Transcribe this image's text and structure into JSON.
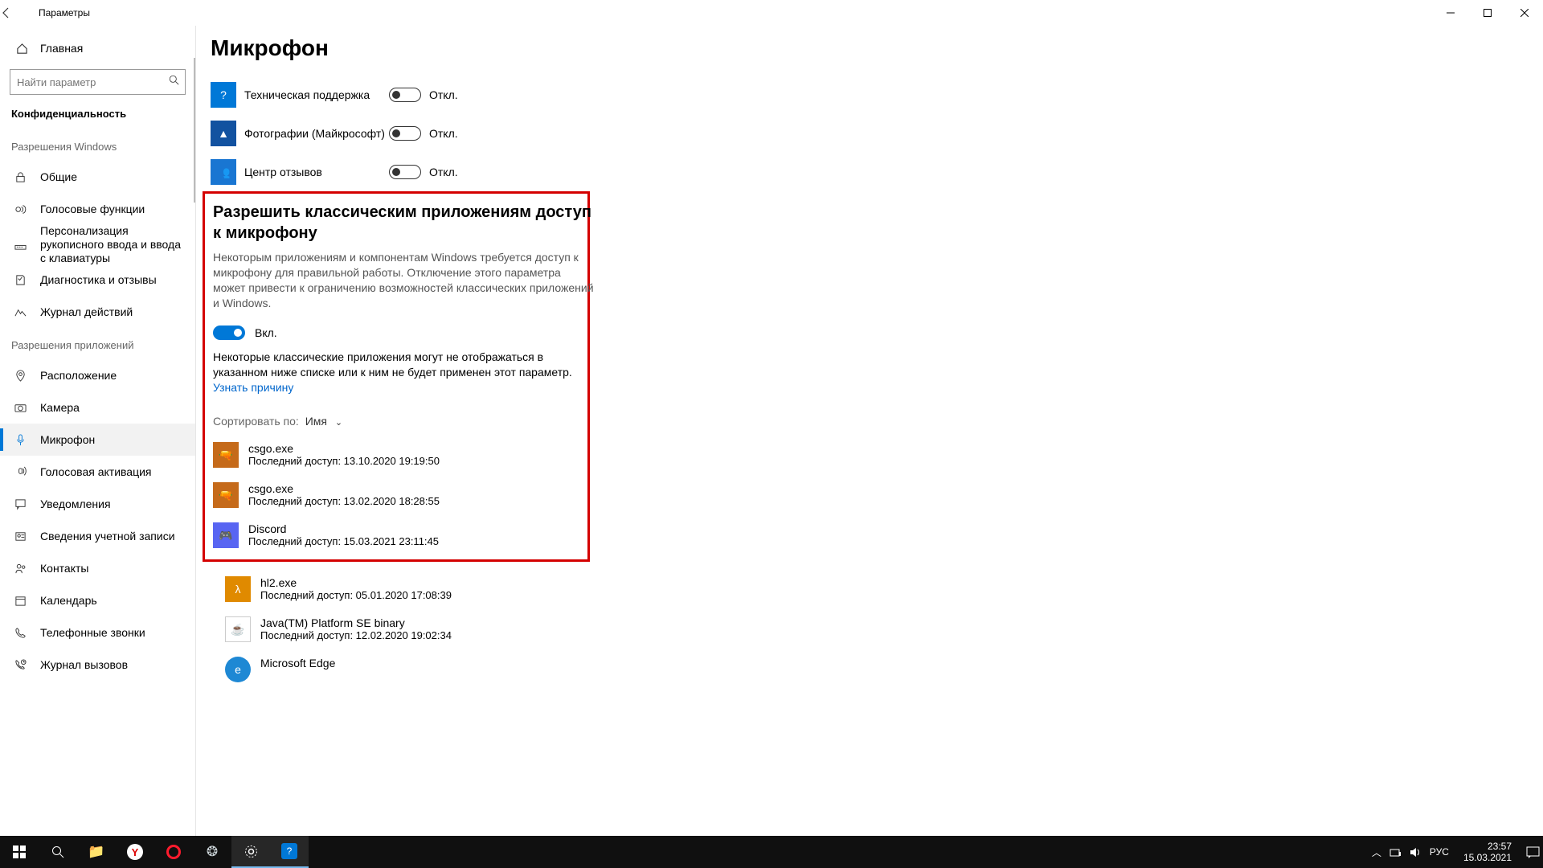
{
  "window": {
    "title": "Параметры"
  },
  "sidebar": {
    "home": "Главная",
    "search_placeholder": "Найти параметр",
    "section": "Конфиденциальность",
    "group_windows": "Разрешения Windows",
    "group_apps": "Разрешения приложений",
    "items_windows": [
      {
        "icon": "lock",
        "label": "Общие"
      },
      {
        "icon": "voice",
        "label": "Голосовые функции"
      },
      {
        "icon": "ink",
        "label": "Персонализация рукописного ввода и ввода с клавиатуры",
        "wrap": true
      },
      {
        "icon": "diag",
        "label": "Диагностика и отзывы"
      },
      {
        "icon": "journal",
        "label": "Журнал действий"
      }
    ],
    "items_apps": [
      {
        "icon": "location",
        "label": "Расположение"
      },
      {
        "icon": "camera",
        "label": "Камера"
      },
      {
        "icon": "mic",
        "label": "Микрофон",
        "active": true
      },
      {
        "icon": "voiceact",
        "label": "Голосовая активация"
      },
      {
        "icon": "notif",
        "label": "Уведомления"
      },
      {
        "icon": "account",
        "label": "Сведения учетной записи"
      },
      {
        "icon": "contacts",
        "label": "Контакты"
      },
      {
        "icon": "calendar",
        "label": "Календарь"
      },
      {
        "icon": "phone",
        "label": "Телефонные звонки"
      },
      {
        "icon": "calllog",
        "label": "Журнал вызовов"
      }
    ]
  },
  "page": {
    "title": "Микрофон",
    "store_apps": [
      {
        "name": "Техническая поддержка",
        "state": "Откл.",
        "icon_bg": "bg-blue",
        "glyph": "?"
      },
      {
        "name": "Фотографии (Майкрософт)",
        "state": "Откл.",
        "icon_bg": "bg-photos",
        "glyph": "▲"
      },
      {
        "name": "Центр отзывов",
        "state": "Откл.",
        "icon_bg": "bg-feedback",
        "glyph": "👥"
      }
    ],
    "desktop_section": {
      "heading": "Разрешить классическим приложениям доступ к микрофону",
      "body": "Некоторым приложениям и компонентам Windows требуется доступ к микрофону для правильной работы. Отключение этого параметра может привести к ограничению возможностей классических приложений и Windows.",
      "toggle_label": "Вкл.",
      "note": "Некоторые классические приложения могут не отображаться в указанном ниже списке или к ним не будет применен этот параметр.",
      "link": "Узнать причину",
      "sort_label": "Сортировать по:",
      "sort_value": "Имя"
    },
    "desktop_apps": [
      {
        "name": "csgo.exe",
        "last": "Последний доступ: 13.10.2020 19:19:50",
        "icon_bg": "bg-orange",
        "glyph": "🔫"
      },
      {
        "name": "csgo.exe",
        "last": "Последний доступ: 13.02.2020 18:28:55",
        "icon_bg": "bg-orange",
        "glyph": "🔫"
      },
      {
        "name": "Discord",
        "last": "Последний доступ: 15.03.2021 23:11:45",
        "icon_bg": "bg-discord",
        "glyph": "🎮"
      },
      {
        "name": "hl2.exe",
        "last": "Последний доступ: 05.01.2020 17:08:39",
        "icon_bg": "bg-halflife",
        "glyph": "λ"
      },
      {
        "name": "Java(TM) Platform SE binary",
        "last": "Последний доступ: 12.02.2020 19:02:34",
        "icon_bg": "bg-java",
        "glyph": "☕"
      },
      {
        "name": "Microsoft Edge",
        "last": "",
        "icon_bg": "bg-edge",
        "glyph": "e"
      }
    ]
  },
  "taskbar": {
    "lang": "РУС",
    "time": "23:57",
    "date": "15.03.2021"
  }
}
